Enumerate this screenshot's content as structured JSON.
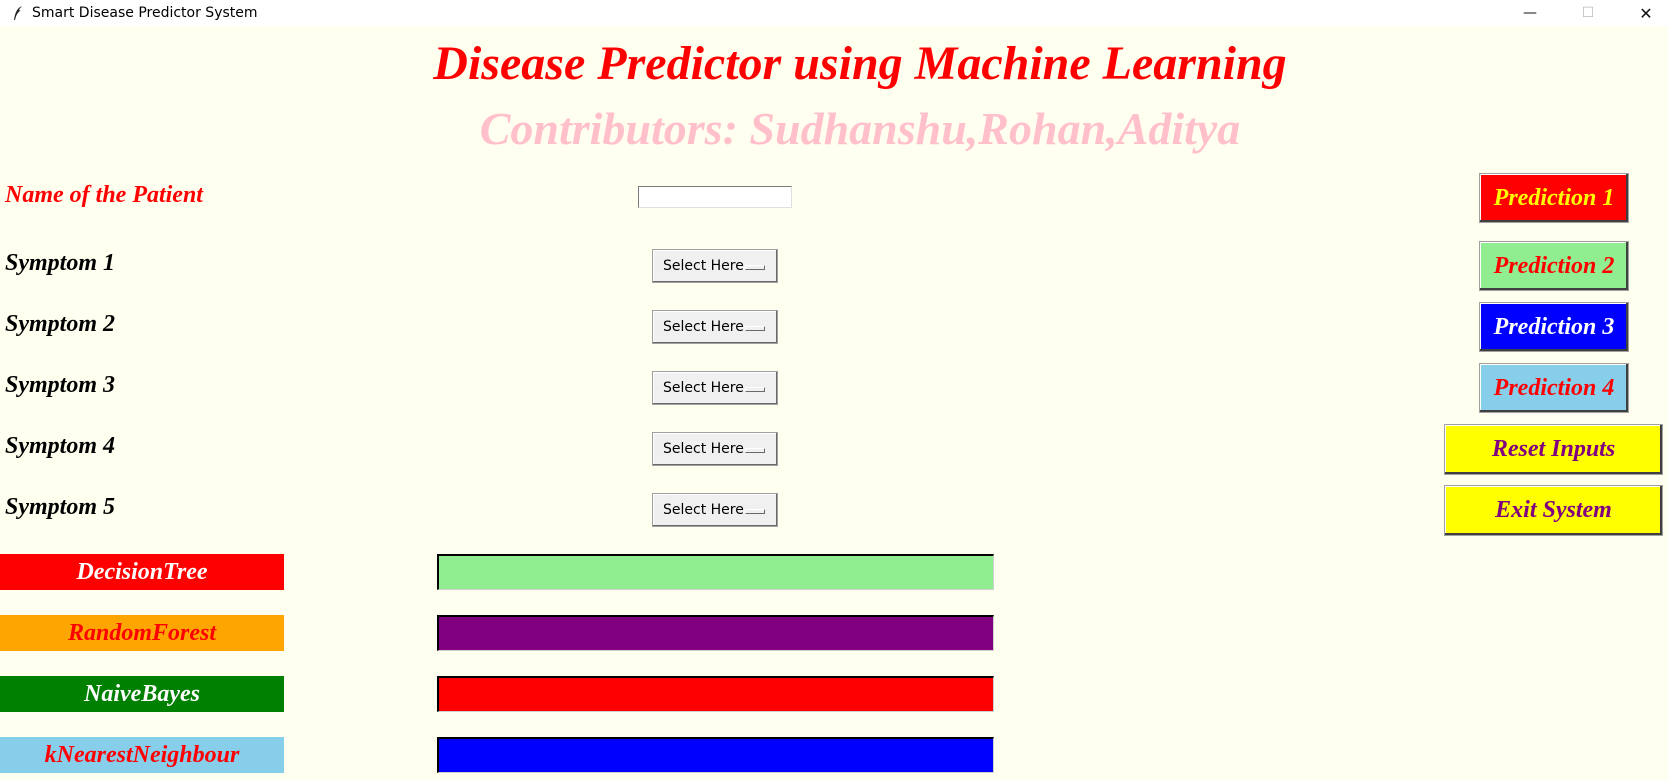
{
  "window": {
    "title": "Smart Disease Predictor System",
    "minimize_glyph": "—",
    "maximize_glyph": "☐",
    "close_glyph": "✕"
  },
  "header": {
    "title": "Disease Predictor using Machine Learning",
    "subtitle": "Contributors: Sudhanshu,Rohan,Aditya"
  },
  "form": {
    "patient_label": "Name of the Patient",
    "patient_name_value": "",
    "symptoms": [
      {
        "label": "Symptom 1",
        "selected": "Select Here"
      },
      {
        "label": "Symptom 2",
        "selected": "Select Here"
      },
      {
        "label": "Symptom 3",
        "selected": "Select Here"
      },
      {
        "label": "Symptom 4",
        "selected": "Select Here"
      },
      {
        "label": "Symptom 5",
        "selected": "Select Here"
      }
    ]
  },
  "algorithms": [
    {
      "label": "DecisionTree",
      "label_bg": "#ff0000",
      "label_fg": "#ffffff",
      "result": "",
      "result_bg": "#90ee90"
    },
    {
      "label": "RandomForest",
      "label_bg": "#ffa500",
      "label_fg": "#ff0000",
      "result": "",
      "result_bg": "#800080"
    },
    {
      "label": "NaiveBayes",
      "label_bg": "#008000",
      "label_fg": "#ffffff",
      "result": "",
      "result_bg": "#ff0000"
    },
    {
      "label": "kNearestNeighbour",
      "label_bg": "#87ceeb",
      "label_fg": "#ff0000",
      "result": "",
      "result_bg": "#0000ff"
    }
  ],
  "actions": {
    "prediction_1": {
      "label": "Prediction 1",
      "bg": "#ff0000",
      "fg": "#ffff00"
    },
    "prediction_2": {
      "label": "Prediction 2",
      "bg": "#90ee90",
      "fg": "#ff0000"
    },
    "prediction_3": {
      "label": "Prediction 3",
      "bg": "#0000ff",
      "fg": "#ffffff"
    },
    "prediction_4": {
      "label": "Prediction 4",
      "bg": "#87ceeb",
      "fg": "#ff0000"
    },
    "reset": {
      "label": "Reset Inputs",
      "bg": "#ffff00",
      "fg": "#800080"
    },
    "exit": {
      "label": "Exit System",
      "bg": "#ffff00",
      "fg": "#800080"
    }
  }
}
